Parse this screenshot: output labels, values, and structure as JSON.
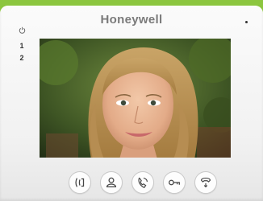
{
  "device": {
    "brand": "Honeywell",
    "side_buttons": [
      {
        "label": "1"
      },
      {
        "label": "2"
      }
    ],
    "side_icon": "power-icon"
  },
  "screen": {
    "content": "video-feed"
  },
  "controls": [
    {
      "icon": "talk-icon"
    },
    {
      "icon": "monitor-icon"
    },
    {
      "icon": "intercom-icon"
    },
    {
      "icon": "unlock-icon"
    },
    {
      "icon": "transfer-icon"
    }
  ],
  "colors": {
    "frame": "#8cc63f",
    "body": "#f4f4f4",
    "brand_text": "#7a7a7a"
  }
}
